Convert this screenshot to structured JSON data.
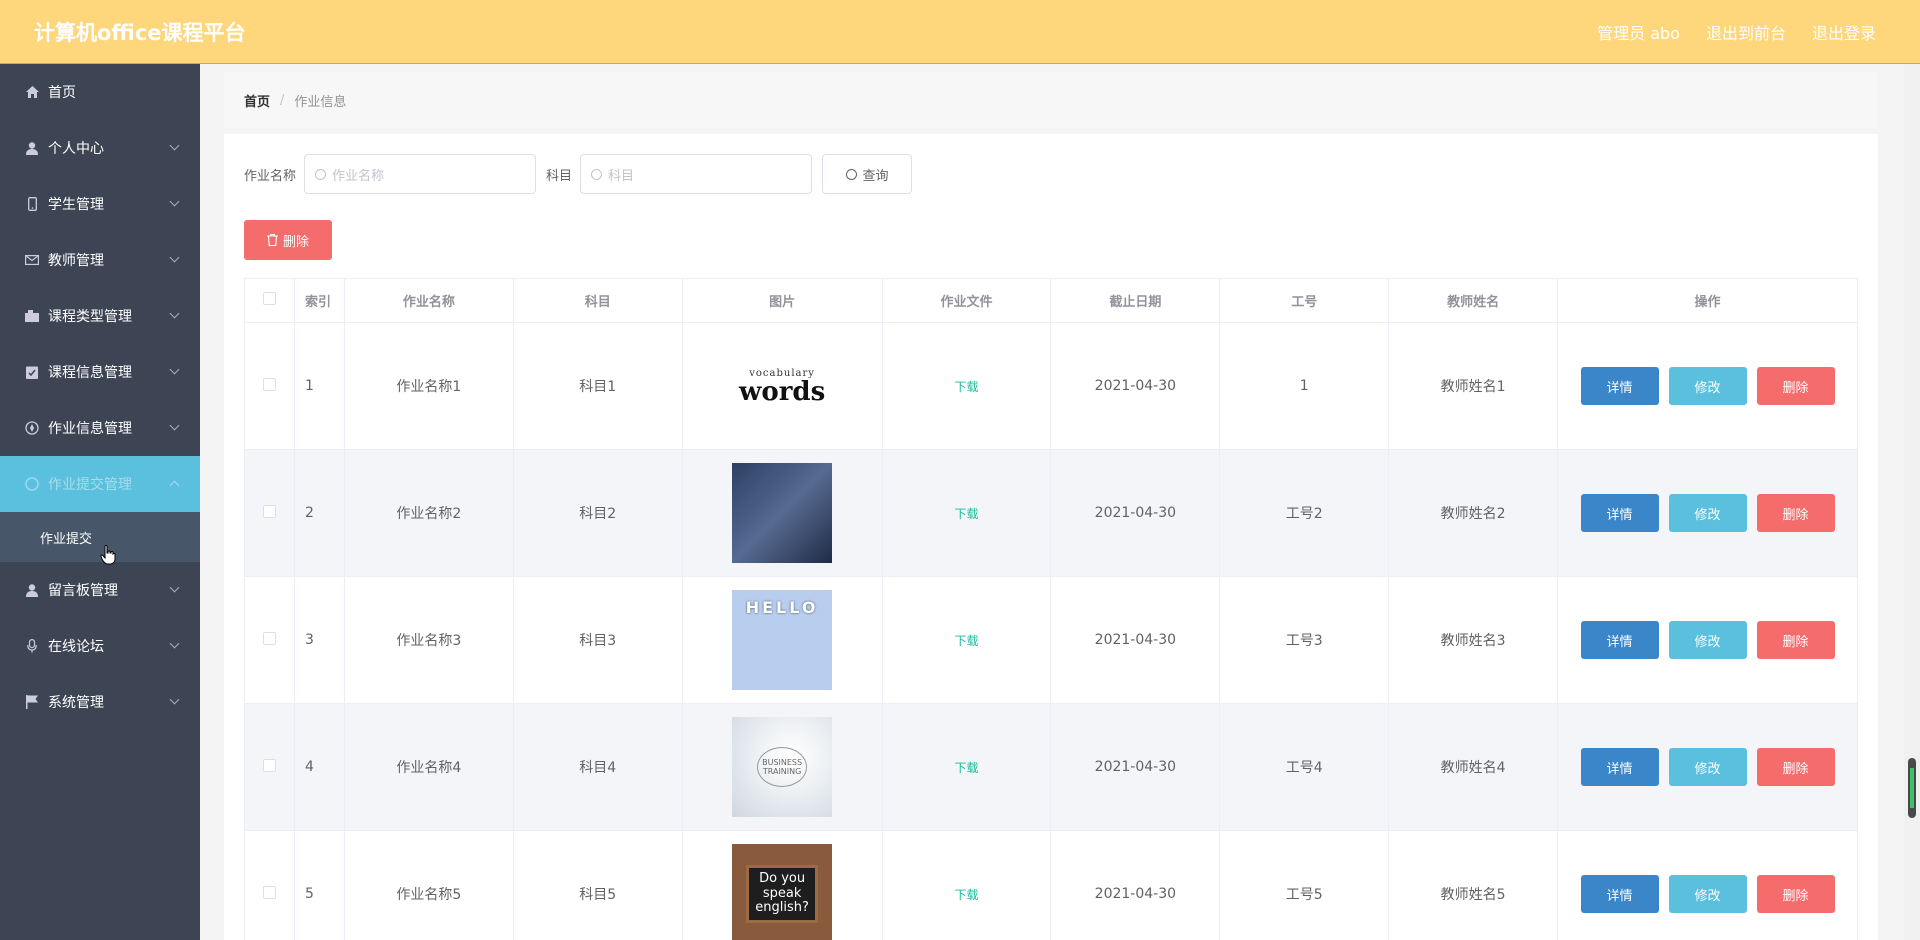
{
  "header": {
    "title": "计算机office课程平台",
    "user": "管理员 abo",
    "to_front": "退出到前台",
    "logout": "退出登录"
  },
  "sidebar": {
    "items": [
      {
        "label": "首页",
        "icon": "home-icon"
      },
      {
        "label": "个人中心",
        "icon": "user-icon"
      },
      {
        "label": "学生管理",
        "icon": "mobile-icon"
      },
      {
        "label": "教师管理",
        "icon": "mail-icon"
      },
      {
        "label": "课程类型管理",
        "icon": "camera-icon"
      },
      {
        "label": "课程信息管理",
        "icon": "clipboard-icon"
      },
      {
        "label": "作业信息管理",
        "icon": "compass-icon"
      },
      {
        "label": "作业提交管理",
        "icon": "circle-icon"
      },
      {
        "label": "留言板管理",
        "icon": "user-icon"
      },
      {
        "label": "在线论坛",
        "icon": "microphone-icon"
      },
      {
        "label": "系统管理",
        "icon": "flag-icon"
      }
    ],
    "submenu": "作业提交"
  },
  "breadcrumb": {
    "home": "首页",
    "sep": "/",
    "current": "作业信息"
  },
  "search": {
    "name_label": "作业名称",
    "name_placeholder": "作业名称",
    "subject_label": "科目",
    "subject_placeholder": "科目",
    "query": "查询"
  },
  "delete_label": "删除",
  "table": {
    "headers": [
      "索引",
      "作业名称",
      "科目",
      "图片",
      "作业文件",
      "截止日期",
      "工号",
      "教师姓名",
      "操作"
    ],
    "rows": [
      {
        "idx": "1",
        "name": "作业名称1",
        "subject": "科目1",
        "file": "下载",
        "date": "2021-04-30",
        "id": "1",
        "teacher": "教师姓名1"
      },
      {
        "idx": "2",
        "name": "作业名称2",
        "subject": "科目2",
        "file": "下载",
        "date": "2021-04-30",
        "id": "工号2",
        "teacher": "教师姓名2"
      },
      {
        "idx": "3",
        "name": "作业名称3",
        "subject": "科目3",
        "file": "下载",
        "date": "2021-04-30",
        "id": "工号3",
        "teacher": "教师姓名3"
      },
      {
        "idx": "4",
        "name": "作业名称4",
        "subject": "科目4",
        "file": "下载",
        "date": "2021-04-30",
        "id": "工号4",
        "teacher": "教师姓名4"
      },
      {
        "idx": "5",
        "name": "作业名称5",
        "subject": "科目5",
        "file": "下载",
        "date": "2021-04-30",
        "id": "工号5",
        "teacher": "教师姓名5"
      }
    ],
    "ops": {
      "detail": "详情",
      "edit": "修改",
      "delete": "删除"
    }
  },
  "thumbs": {
    "t1_word": "words",
    "t1_sub": "vocabulary",
    "t3_word": "HELLO",
    "t4_word": "BUSINESS TRAINING",
    "t5_l1": "Do you",
    "t5_l2": "speak",
    "t5_l3": "english?"
  },
  "colors": {
    "header_bg": "#fed67b",
    "sidebar_bg": "#3d4555",
    "active_menu": "#5bc0de",
    "detail_btn": "#3a86c8",
    "edit_btn": "#5bc0de",
    "delete_btn": "#f56c6c",
    "download_link": "#1abc9c"
  }
}
